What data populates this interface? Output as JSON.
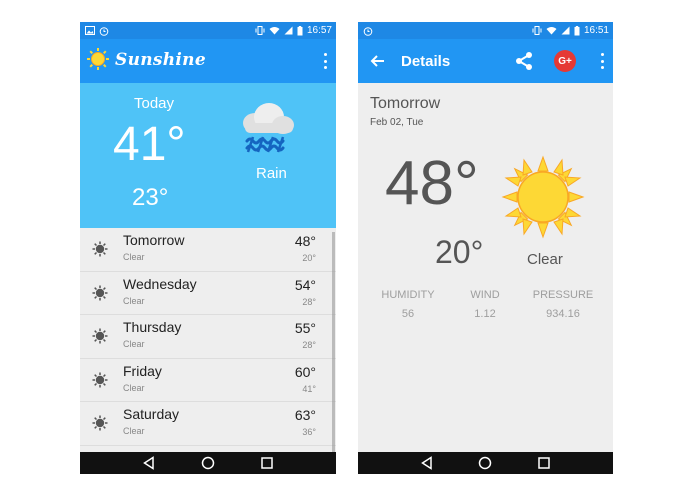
{
  "left_screen": {
    "status_bar": {
      "time": "16:57"
    },
    "app_bar": {
      "title": "Sunshine"
    },
    "today": {
      "label": "Today",
      "high": "41°",
      "low": "23°",
      "description": "Rain",
      "icon": "rain-cloud-icon"
    },
    "forecast": [
      {
        "day": "Tomorrow",
        "desc": "Clear",
        "high": "48°",
        "low": "20°",
        "icon": "sun-icon"
      },
      {
        "day": "Wednesday",
        "desc": "Clear",
        "high": "54°",
        "low": "28°",
        "icon": "sun-icon"
      },
      {
        "day": "Thursday",
        "desc": "Clear",
        "high": "55°",
        "low": "28°",
        "icon": "sun-icon"
      },
      {
        "day": "Friday",
        "desc": "Clear",
        "high": "60°",
        "low": "41°",
        "icon": "sun-icon"
      },
      {
        "day": "Saturday",
        "desc": "Clear",
        "high": "63°",
        "low": "36°",
        "icon": "sun-icon"
      }
    ]
  },
  "right_screen": {
    "status_bar": {
      "time": "16:51"
    },
    "app_bar": {
      "title": "Details",
      "gplus_label": "G+"
    },
    "details": {
      "day": "Tomorrow",
      "date": "Feb 02, Tue",
      "high": "48°",
      "low": "20°",
      "description": "Clear",
      "icon": "sun-icon",
      "stats": {
        "humidity_label": "HUMIDITY",
        "humidity": "56",
        "wind_label": "WIND",
        "wind": "1.12",
        "pressure_label": "PRESSURE",
        "pressure": "934.16"
      }
    }
  },
  "colors": {
    "status_bar": "#1e88e5",
    "app_bar": "#2196f3",
    "today_panel": "#4fc3f7",
    "background": "#eeeeee",
    "gplus": "#e53935",
    "sun": "#fdd835"
  }
}
